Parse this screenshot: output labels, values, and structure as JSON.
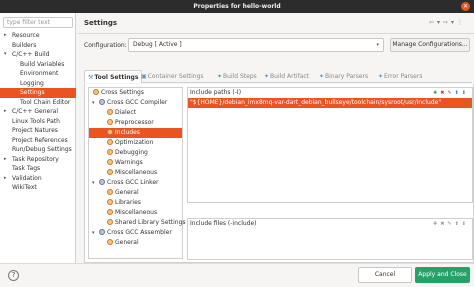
{
  "window": {
    "title": "Properties for hello-world"
  },
  "filter": {
    "placeholder": "type filter text"
  },
  "nav": {
    "items": [
      {
        "label": "Resource",
        "arrow": "▸"
      },
      {
        "label": "Builders",
        "arrow": ""
      },
      {
        "label": "C/C++ Build",
        "arrow": "▾"
      },
      {
        "label": "Build Variables",
        "arrow": ""
      },
      {
        "label": "Environment",
        "arrow": ""
      },
      {
        "label": "Logging",
        "arrow": ""
      },
      {
        "label": "Settings",
        "arrow": ""
      },
      {
        "label": "Tool Chain Editor",
        "arrow": ""
      },
      {
        "label": "C/C++ General",
        "arrow": "▸"
      },
      {
        "label": "Linux Tools Path",
        "arrow": ""
      },
      {
        "label": "Project Natures",
        "arrow": ""
      },
      {
        "label": "Project References",
        "arrow": ""
      },
      {
        "label": "Run/Debug Settings",
        "arrow": ""
      },
      {
        "label": "Task Repository",
        "arrow": "▸"
      },
      {
        "label": "Task Tags",
        "arrow": ""
      },
      {
        "label": "Validation",
        "arrow": "▸"
      },
      {
        "label": "WikiText",
        "arrow": ""
      }
    ]
  },
  "header": {
    "title": "Settings"
  },
  "config": {
    "label": "Configuration:",
    "value": "Debug  [ Active ]",
    "manage_label": "Manage Configurations..."
  },
  "tabs": [
    {
      "label": "Tool Settings"
    },
    {
      "label": "Container Settings"
    },
    {
      "label": "Build Steps"
    },
    {
      "label": "Build Artifact"
    },
    {
      "label": "Binary Parsers"
    },
    {
      "label": "Error Parsers"
    }
  ],
  "tree": {
    "nodes": [
      {
        "label": "Cross Settings"
      },
      {
        "label": "Cross GCC Compiler",
        "arrow": "▾"
      },
      {
        "label": "Dialect"
      },
      {
        "label": "Preprocessor"
      },
      {
        "label": "Includes"
      },
      {
        "label": "Optimization"
      },
      {
        "label": "Debugging"
      },
      {
        "label": "Warnings"
      },
      {
        "label": "Miscellaneous"
      },
      {
        "label": "Cross GCC Linker",
        "arrow": "▾"
      },
      {
        "label": "General"
      },
      {
        "label": "Libraries"
      },
      {
        "label": "Miscellaneous"
      },
      {
        "label": "Shared Library Settings"
      },
      {
        "label": "Cross GCC Assembler",
        "arrow": "▾"
      },
      {
        "label": "General"
      }
    ]
  },
  "include_paths": {
    "header": "Include paths (-I)",
    "items": [
      "\"${HOME}/debian_imx8mq-var-dart_debian_bullseye/toolchain/sysroot/usr/include\""
    ]
  },
  "include_files": {
    "header": "Include files (-include)"
  },
  "footer": {
    "cancel_label": "Cancel",
    "apply_label": "Apply and Close",
    "help_label": "?"
  },
  "icons": {
    "gear": "gear-icon",
    "help": "help-icon"
  },
  "colors": {
    "accent": "#e95420",
    "apply": "#26a269",
    "titlebar": "#2c2c2c"
  }
}
